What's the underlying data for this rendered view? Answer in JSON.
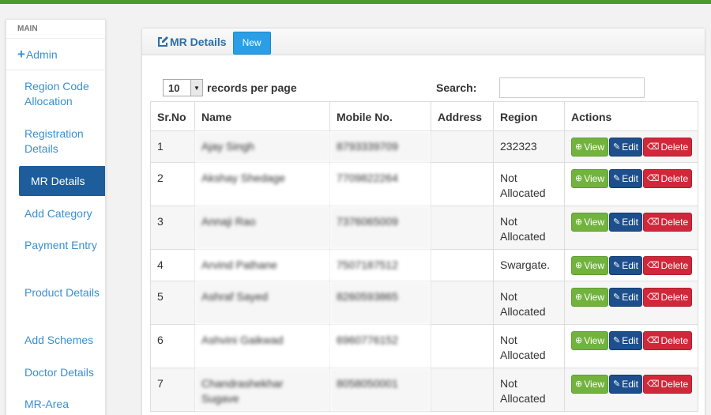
{
  "sidebar": {
    "heading": "MAIN",
    "admin_label": "Admin",
    "items": [
      {
        "label": "Region Code Allocation",
        "active": false
      },
      {
        "label": "Registration Details",
        "active": false
      },
      {
        "label": "MR Details",
        "active": true
      },
      {
        "label": "Add Category",
        "active": false
      },
      {
        "label": "Payment Entry",
        "active": false
      },
      {
        "label": "Product Details",
        "active": false
      },
      {
        "label": "Add Schemes",
        "active": false
      },
      {
        "label": "Doctor Details",
        "active": false
      },
      {
        "label": "MR-Area",
        "active": false
      }
    ]
  },
  "panel": {
    "title": "MR Details",
    "new_label": "New"
  },
  "controls": {
    "page_size": "10",
    "records_label": "records per page",
    "search_label": "Search:",
    "search_value": ""
  },
  "table": {
    "headers": [
      "Sr.No",
      "Name",
      "Mobile No.",
      "Address",
      "Region",
      "Actions"
    ],
    "rows": [
      {
        "sr": "1",
        "name": "Ajay Singh",
        "mobile": "8793339709",
        "address": "",
        "region": "232323"
      },
      {
        "sr": "2",
        "name": "Akshay Shedage",
        "mobile": "7709822264",
        "address": "",
        "region": "Not Allocated"
      },
      {
        "sr": "3",
        "name": "Annaji Rao",
        "mobile": "7376065009",
        "address": "",
        "region": "Not Allocated"
      },
      {
        "sr": "4",
        "name": "Arvind Pathane",
        "mobile": "7507187512",
        "address": "",
        "region": "Swargate."
      },
      {
        "sr": "5",
        "name": "Ashraf Sayed",
        "mobile": "8260593865",
        "address": "",
        "region": "Not Allocated"
      },
      {
        "sr": "6",
        "name": "Ashvini Gaikwad",
        "mobile": "6960776152",
        "address": "",
        "region": "Not Allocated"
      },
      {
        "sr": "7",
        "name": "Chandrashekhar Sugave",
        "mobile": "8058050001",
        "address": "",
        "region": "Not Allocated"
      }
    ],
    "actions": {
      "view": "View",
      "edit": "Edit",
      "delete": "Delete"
    }
  },
  "colors": {
    "accent_green": "#4a9a2c",
    "link_blue": "#3a8fd1",
    "active_nav": "#1d5d9b",
    "view_btn": "#72b33e",
    "edit_btn": "#1d4f8c",
    "delete_btn": "#d0283a"
  },
  "icons": {
    "admin": "plus-icon",
    "title": "edit-square-icon",
    "view": "zoom-in-icon",
    "edit": "edit-square-icon",
    "delete": "trash-icon"
  }
}
